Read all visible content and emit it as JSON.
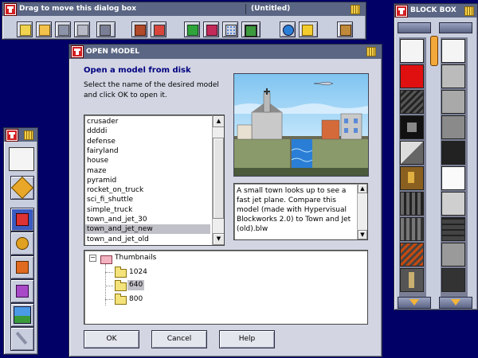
{
  "toolbar": {
    "title": "Drag to move this dialog box",
    "doc_title": "(Untitled)",
    "buttons": [
      "new",
      "open",
      "save",
      "print",
      "move",
      "toolbox",
      "palette",
      "grid",
      "undo",
      "dots",
      "monitor",
      "globe",
      "help",
      "exit"
    ]
  },
  "block_box": {
    "title": "BLOCK BOX"
  },
  "dialog": {
    "title": "OPEN MODEL",
    "heading": "Open a model from disk",
    "instruction": "Select the name of the desired model and click OK to open it.",
    "models": [
      "crusader",
      "ddddi",
      "defense",
      "fairyland",
      "house",
      "maze",
      "pyramid",
      "rocket_on_truck",
      "sci_fi_shuttle",
      "simple_truck",
      "town_and_jet_30",
      "town_and_jet_new",
      "town_and_jet_old"
    ],
    "selected_model": "town_and_jet_new",
    "description": "A small town looks up to see a fast jet plane. Compare this model (made with Hypervisual Blockworks 2.0) to Town and Jet (old).blw",
    "tree": {
      "root": "Thumbnails",
      "children": [
        "1024",
        "640",
        "800"
      ],
      "expand_glyph": "−"
    },
    "buttons": {
      "ok": "OK",
      "cancel": "Cancel",
      "help": "Help"
    }
  },
  "colors": {
    "desktop": "#000066",
    "titlebar": "#5a6683",
    "panel": "#c9cede",
    "selection": "#c0c0c8",
    "heading": "#000080"
  }
}
